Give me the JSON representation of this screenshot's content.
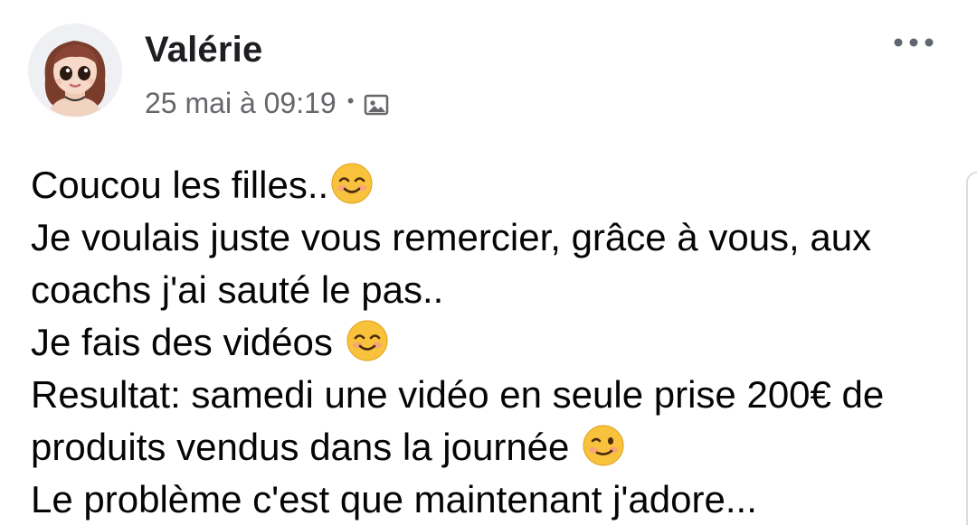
{
  "post": {
    "author": "Valérie",
    "timestamp": "25 mai à 09:19",
    "separator": "•",
    "privacy_icon": "photo-audience-icon",
    "more_icon": "more-options-icon",
    "avatar_icon": "profile-avatar",
    "message_lines": [
      {
        "text": "Coucou les filles..",
        "emoji": "smiling-face-icon"
      },
      {
        "text": "Je voulais juste vous remercier, grâce à vous, aux",
        "emoji": ""
      },
      {
        "text": "coachs j'ai sauté le pas..",
        "emoji": ""
      },
      {
        "text": "Je fais des vidéos ",
        "emoji": "smiling-face-icon"
      },
      {
        "text": "Resultat: samedi une vidéo en seule prise 200€ de",
        "emoji": ""
      },
      {
        "text": "produits vendus dans la journée ",
        "emoji": "winking-face-icon"
      },
      {
        "text": "Le problème c'est que maintenant j'adore...",
        "emoji": ""
      }
    ]
  },
  "colors": {
    "text_primary": "#050505",
    "text_secondary": "#65676b",
    "background": "#ffffff",
    "emoji_yellow": "#f9c23c"
  }
}
